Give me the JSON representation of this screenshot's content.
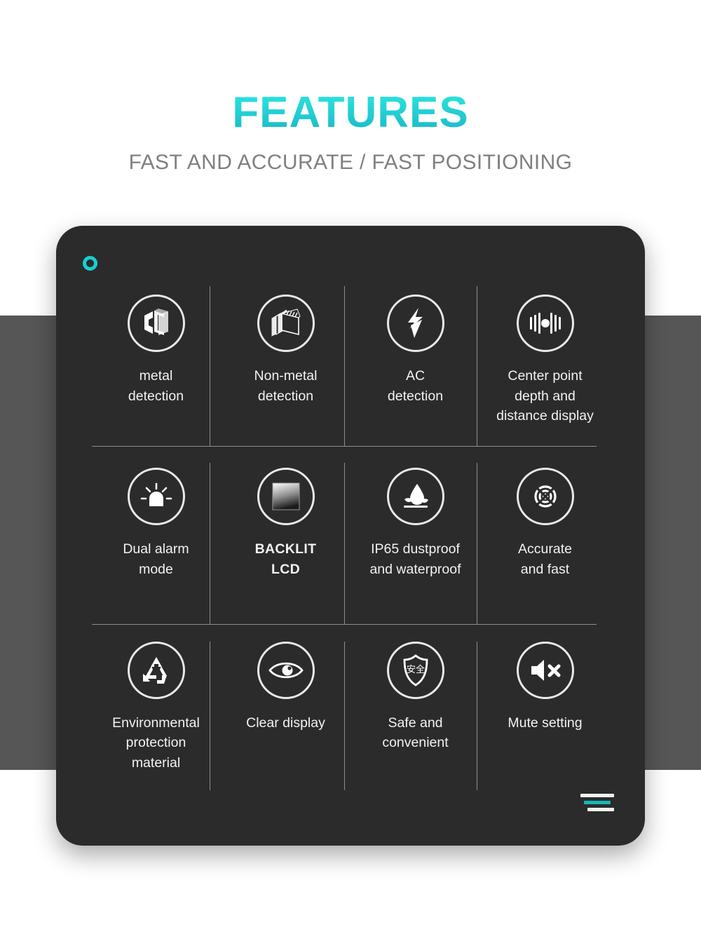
{
  "header": {
    "title": "FEATURES",
    "subtitle": "FAST AND ACCURATE / FAST POSITIONING",
    "title_color": "#22d3d6",
    "subtitle_color": "#808080"
  },
  "card": {
    "background_color": "#2b2b2b",
    "accent_color": "#17cfd0",
    "corner_dot_name": "ring-dot-decoration",
    "corner_lines_name": "stacked-lines-decoration"
  },
  "features": [
    {
      "icon": "i-beam-metal-icon",
      "label": "metal\ndetection",
      "bold": false
    },
    {
      "icon": "layered-blocks-icon",
      "label": "Non-metal\ndetection",
      "bold": false
    },
    {
      "icon": "lightning-bolt-icon",
      "label": "AC\ndetection",
      "bold": false
    },
    {
      "icon": "center-point-bars-icon",
      "label": "Center point\ndepth and\ndistance display",
      "bold": false
    },
    {
      "icon": "alarm-beacon-icon",
      "label": "Dual alarm\nmode",
      "bold": false
    },
    {
      "icon": "lcd-screen-icon",
      "label": "BACKLIT\nLCD",
      "bold": true
    },
    {
      "icon": "water-droplet-icon",
      "label": "IP65 dustproof\nand waterproof",
      "bold": false
    },
    {
      "icon": "target-rings-icon",
      "label": "Accurate\nand fast",
      "bold": false
    },
    {
      "icon": "recycle-icon",
      "label": "Environmental\nprotection\nmaterial",
      "bold": false
    },
    {
      "icon": "eye-icon",
      "label": "Clear display",
      "bold": false
    },
    {
      "icon": "shield-safety-icon",
      "label": "Safe and\nconvenient",
      "bold": false,
      "shield_text": "安全"
    },
    {
      "icon": "speaker-mute-icon",
      "label": "Mute setting",
      "bold": false
    }
  ],
  "background": {
    "page_color": "#ffffff",
    "band_color": "#565656"
  }
}
